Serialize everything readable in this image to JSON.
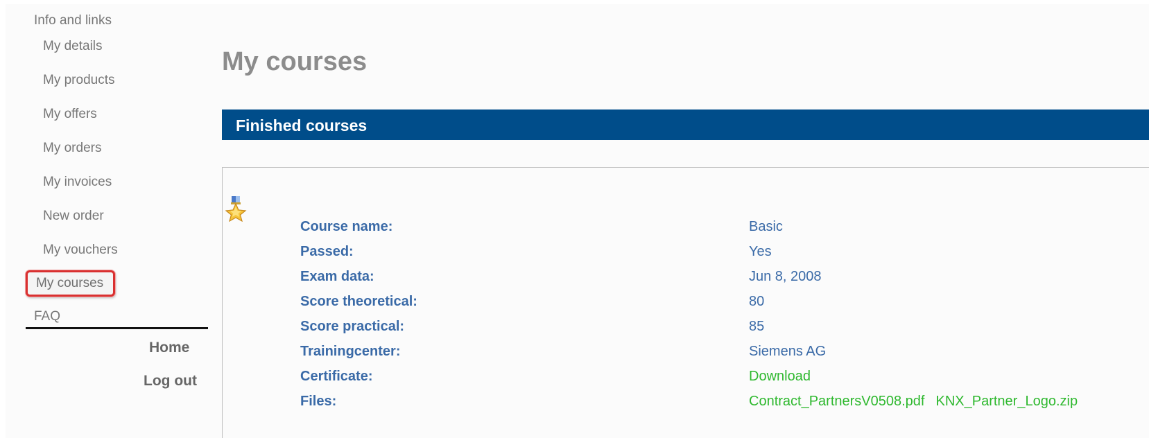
{
  "sidebar": {
    "heading": "Info and links",
    "items": [
      {
        "label": "My details"
      },
      {
        "label": "My products"
      },
      {
        "label": "My offers"
      },
      {
        "label": "My orders"
      },
      {
        "label": "My invoices"
      },
      {
        "label": "New order"
      },
      {
        "label": "My vouchers"
      },
      {
        "label": "My courses"
      }
    ],
    "faq": "FAQ",
    "home": "Home",
    "logout": "Log out"
  },
  "main": {
    "title": "My courses",
    "section_title": "Finished courses",
    "course": {
      "icon": "medal-icon",
      "rows": [
        {
          "label": "Course name:",
          "value": "Basic"
        },
        {
          "label": "Passed:",
          "value": "Yes"
        },
        {
          "label": "Exam data:",
          "value": "Jun 8, 2008"
        },
        {
          "label": "Score theoretical:",
          "value": "80"
        },
        {
          "label": "Score practical:",
          "value": "85"
        },
        {
          "label": "Trainingcenter:",
          "value": "Siemens AG"
        },
        {
          "label": "Certificate:",
          "value": "Download"
        },
        {
          "label": "Files:",
          "files": [
            "Contract_PartnersV0508.pdf",
            "KNX_Partner_Logo.zip"
          ]
        }
      ]
    }
  },
  "colors": {
    "section_bar": "#004d8a",
    "label_blue": "#3a6aa7",
    "link_green": "#2eb82e",
    "highlight_red": "#d93030"
  }
}
